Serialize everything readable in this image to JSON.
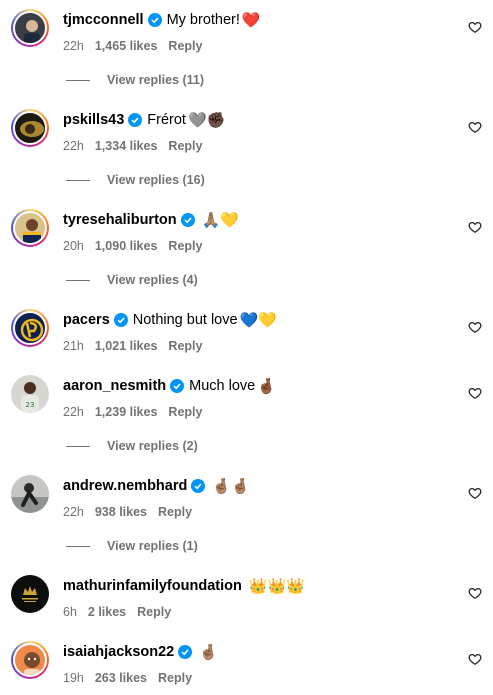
{
  "colors": {
    "secondary_text": "#737373",
    "verified_blue": "#0095f6",
    "story_ring": "#d62976"
  },
  "comments": [
    {
      "username": "tjmcconnell",
      "verified": true,
      "text": "My brother!",
      "emoji": "❤️",
      "time": "22h",
      "likes": "1,465 likes",
      "reply": "Reply",
      "view_replies": "View replies (11)"
    },
    {
      "username": "pskills43",
      "verified": true,
      "text": "Frérot",
      "emoji": "🩶✊🏿",
      "time": "22h",
      "likes": "1,334 likes",
      "reply": "Reply",
      "view_replies": "View replies (16)"
    },
    {
      "username": "tyresehaliburton",
      "verified": true,
      "text": "",
      "emoji": "🙏🏽💛",
      "time": "20h",
      "likes": "1,090 likes",
      "reply": "Reply",
      "view_replies": "View replies (4)"
    },
    {
      "username": "pacers",
      "verified": true,
      "text": "Nothing but love",
      "emoji": "💙💛",
      "time": "21h",
      "likes": "1,021 likes",
      "reply": "Reply",
      "view_replies": ""
    },
    {
      "username": "aaron_nesmith",
      "verified": true,
      "text": "Much love",
      "emoji": "🤞🏾",
      "time": "22h",
      "likes": "1,239 likes",
      "reply": "Reply",
      "view_replies": "View replies (2)"
    },
    {
      "username": "andrew.nembhard",
      "verified": true,
      "text": "",
      "emoji": "🤞🏽🤞🏽",
      "time": "22h",
      "likes": "938 likes",
      "reply": "Reply",
      "view_replies": "View replies (1)"
    },
    {
      "username": "mathurinfamilyfoundation",
      "verified": false,
      "text": "",
      "emoji": "👑👑👑",
      "time": "6h",
      "likes": "2 likes",
      "reply": "Reply",
      "view_replies": ""
    },
    {
      "username": "isaiahjackson22",
      "verified": true,
      "text": "",
      "emoji": "🤞🏽",
      "time": "19h",
      "likes": "263 likes",
      "reply": "Reply",
      "view_replies": ""
    }
  ]
}
